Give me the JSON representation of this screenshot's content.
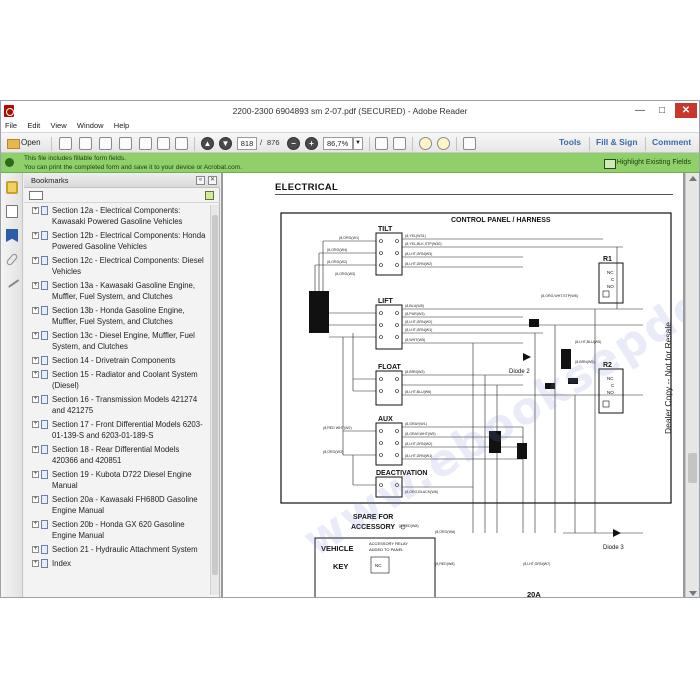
{
  "window": {
    "title": "2200-2300 6904893 sm 2-07.pdf (SECURED) - Adobe Reader",
    "minimize": "—",
    "maximize": "□",
    "close": "✕"
  },
  "menu": [
    "File",
    "Edit",
    "View",
    "Window",
    "Help"
  ],
  "toolbar": {
    "open_label": "Open",
    "page_current": "818",
    "page_separator": "/",
    "page_total": "876",
    "zoom": "86,7%",
    "zoom_out": "−",
    "zoom_in": "+",
    "tools_label": "Tools",
    "fill_sign_label": "Fill & Sign",
    "comment_label": "Comment"
  },
  "notification": {
    "line1": "This file includes fillable form fields.",
    "line2": "You can print the completed form and save it to your device or Acrobat.com.",
    "highlight_label": "Highlight Existing Fields"
  },
  "bookmarks": {
    "header": "Bookmarks",
    "items": [
      "Section 12a - Electrical Components: Kawasaki Powered Gasoline Vehicles",
      "Section 12b - Electrical Components: Honda Powered Gasoline Vehicles",
      "Section 12c - Electrical Components: Diesel Vehicles",
      "Section 13a - Kawasaki Gasoline Engine, Muffler, Fuel System, and Clutches",
      "Section 13b - Honda Gasoline Engine, Muffler, Fuel System, and Clutches",
      "Section 13c - Diesel Engine, Muffler, Fuel System, and Clutches",
      "Section 14 - Drivetrain Components",
      "Section 15 - Radiator and Coolant System (Diesel)",
      "Section 16 - Transmission Models 421274 and 421275",
      "Section 17 - Front Differential Models 6203-01-139-S and 6203-01-189-S",
      "Section 18 - Rear Differential Models 420366 and 420851",
      "Section 19 - Kubota D722 Diesel Engine Manual",
      "Section 20a - Kawasaki FH680D Gasoline Engine Manual",
      "Section 20b - Honda GX 620 Gasoline Engine Manual",
      "Section 21 - Hydraulic Attachment System",
      "Index"
    ]
  },
  "document": {
    "heading": "ELECTRICAL",
    "side_note": "Dealer Copy -- Not for Resale",
    "watermark": "www.ebooksepdo.com",
    "schematic": {
      "panel_title": "CONTROL PANEL / HARNESS",
      "switch_tilt": "TILT",
      "switch_lift": "LIFT",
      "switch_float": "FLOAT",
      "switch_aux": "AUX",
      "switch_deactivation": "DEACTIVATION",
      "relay_r1": "R1",
      "relay_r2": "R2",
      "diode2": "Diode 2",
      "diode3": "Diode 3",
      "spare": "SPARE FOR",
      "spare2": "ACCESSORY",
      "vehicle": "VEHICLE",
      "key": "KEY",
      "accessory_relay": "ACCESSORY RELAY",
      "accessory_relay2": "ADDED TO PANEL",
      "label_20a": "20A",
      "wire_labels": [
        "(8,YEL(W31)",
        "(8,YEL,BLK,STP(W30)",
        "(8,LHT,GRN(W3)",
        "(8,LHT,GRN(W2)",
        "(8,ORG(W1)",
        "(8,ORG(W4)",
        "(8,ORG(W2)",
        "(8,ORG(W3)",
        "(8,BLU(W5)",
        "(8,PUR(W3)",
        "(8,LHT,GRN(W2)",
        "(8,LHT,GRN(W1)",
        "(8,WHT(W5)",
        "(8,BRN(W3)",
        "(8,LHT,BLU(W6)",
        "(8,GRAY(W1)",
        "(8,GRAY,WHT(W5)",
        "(8,LHT,GRN(W2)",
        "(8,LHT,GRN(W1)",
        "(8,RED WHT(W2)",
        "(8,ORG(W3)",
        "(8,ORG,BLACK(W6)",
        "(8,ORG,WHT,STP(W6)",
        "(8,LHT,BLU(W5)",
        "(8,BRN(W5)",
        "(8,RED(W8)",
        "(8,ORG(W6)",
        "(8,RED(W8)",
        "(8,LHT,GRN(W7)"
      ],
      "relay_contacts": [
        "NC",
        "C",
        "NO"
      ]
    }
  }
}
